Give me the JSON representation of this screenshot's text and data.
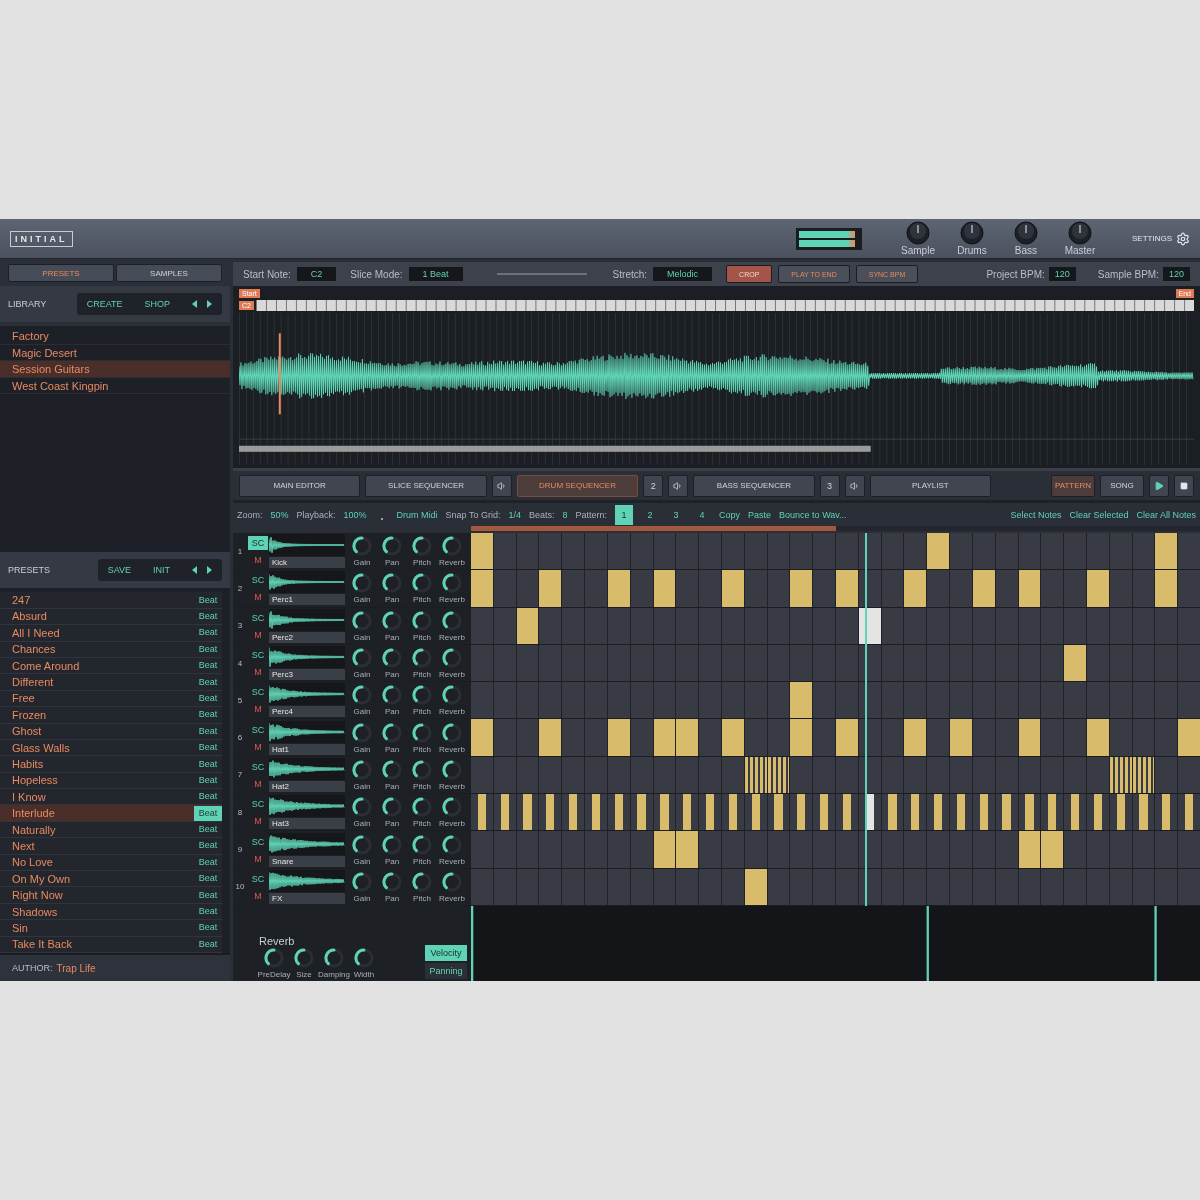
{
  "header": {
    "logo": "INITIAL",
    "meter": {
      "level": 0.93
    },
    "knobs": [
      {
        "label": "Sample"
      },
      {
        "label": "Drums"
      },
      {
        "label": "Bass"
      },
      {
        "label": "Master"
      }
    ],
    "settings": "SETTINGS"
  },
  "sidebar": {
    "tabs": [
      {
        "label": "PRESETS",
        "selected": true
      },
      {
        "label": "SAMPLES",
        "selected": false
      }
    ],
    "library": {
      "title": "LIBRARY",
      "buttons": [
        "CREATE",
        "SHOP"
      ],
      "items": [
        {
          "label": "Factory",
          "selected": false
        },
        {
          "label": "Magic Desert",
          "selected": false
        },
        {
          "label": "Session Guitars",
          "selected": true
        },
        {
          "label": "West Coast Kingpin",
          "selected": false
        }
      ]
    },
    "presets": {
      "title": "PRESETS",
      "buttons": [
        "SAVE",
        "INIT"
      ],
      "items": [
        {
          "name": "247",
          "tag": "Beat",
          "selected": false
        },
        {
          "name": "Absurd",
          "tag": "Beat",
          "selected": false
        },
        {
          "name": "All I Need",
          "tag": "Beat",
          "selected": false
        },
        {
          "name": "Chances",
          "tag": "Beat",
          "selected": false
        },
        {
          "name": "Come Around",
          "tag": "Beat",
          "selected": false
        },
        {
          "name": "Different",
          "tag": "Beat",
          "selected": false
        },
        {
          "name": "Free",
          "tag": "Beat",
          "selected": false
        },
        {
          "name": "Frozen",
          "tag": "Beat",
          "selected": false
        },
        {
          "name": "Ghost",
          "tag": "Beat",
          "selected": false
        },
        {
          "name": "Glass Walls",
          "tag": "Beat",
          "selected": false
        },
        {
          "name": "Habits",
          "tag": "Beat",
          "selected": false
        },
        {
          "name": "Hopeless",
          "tag": "Beat",
          "selected": false
        },
        {
          "name": "I Know",
          "tag": "Beat",
          "selected": false
        },
        {
          "name": "Interlude",
          "tag": "Beat",
          "selected": true
        },
        {
          "name": "Naturally",
          "tag": "Beat",
          "selected": false
        },
        {
          "name": "Next",
          "tag": "Beat",
          "selected": false
        },
        {
          "name": "No Love",
          "tag": "Beat",
          "selected": false
        },
        {
          "name": "On My Own",
          "tag": "Beat",
          "selected": false
        },
        {
          "name": "Right Now",
          "tag": "Beat",
          "selected": false
        },
        {
          "name": "Shadows",
          "tag": "Beat",
          "selected": false
        },
        {
          "name": "Sin",
          "tag": "Beat",
          "selected": false
        },
        {
          "name": "Take It Back",
          "tag": "Beat",
          "selected": false
        }
      ]
    },
    "author": {
      "label": "AUTHOR:",
      "value": "Trap Life"
    }
  },
  "sample_bar": {
    "fields": [
      {
        "label": "Start Note:",
        "value": "C2"
      },
      {
        "label": "Slice Mode:",
        "value": "1 Beat"
      },
      {
        "label": "Stretch:",
        "value": "Melodic"
      }
    ],
    "buttons": [
      {
        "label": "CROP",
        "on": true
      },
      {
        "label": "PLAY TO END",
        "on": false
      },
      {
        "label": "SYNC BPM",
        "on": false
      }
    ],
    "bpm": [
      {
        "label": "Project BPM:",
        "value": "120"
      },
      {
        "label": "Sample BPM:",
        "value": "120"
      }
    ]
  },
  "waveform": {
    "start": "Start",
    "end": "End",
    "note": "C2"
  },
  "editor_tabs": [
    {
      "label": "MAIN EDITOR",
      "selected": false,
      "speaker": false
    },
    {
      "label": "SLICE SEQUENCER",
      "selected": false,
      "speaker": true
    },
    {
      "label": "DRUM SEQUENCER",
      "selected": true,
      "count": "2",
      "speaker": true
    },
    {
      "label": "BASS SEQUENCER",
      "selected": false,
      "count": "3",
      "speaker": true
    },
    {
      "label": "PLAYLIST",
      "selected": false,
      "speaker": false
    }
  ],
  "modes": [
    {
      "label": "PATTERN",
      "selected": true
    },
    {
      "label": "SONG",
      "selected": false
    }
  ],
  "seq_toolbar": {
    "zoom": {
      "label": "Zoom:",
      "value": "50%"
    },
    "playback": {
      "label": "Playback:",
      "value": "100%"
    },
    "drum_midi": "Drum Midi",
    "snap": {
      "label": "Snap To Grid:",
      "value": "1/4"
    },
    "beats": {
      "label": "Beats:",
      "value": "8"
    },
    "pattern": {
      "label": "Pattern:",
      "items": [
        {
          "label": "1",
          "selected": true
        },
        {
          "label": "2",
          "selected": false
        },
        {
          "label": "3",
          "selected": false
        },
        {
          "label": "4",
          "selected": false
        }
      ]
    },
    "actions": [
      "Copy",
      "Paste",
      "Bounce to Wav..."
    ],
    "note_actions": [
      "Select Notes",
      "Clear Selected",
      "Clear All Notes"
    ]
  },
  "loop": {
    "level": 0.5
  },
  "playhead": {
    "level": 0.54
  },
  "tracks": [
    {
      "number": "1",
      "sc": {
        "label": "SC",
        "selected": true
      },
      "mute": "M",
      "name": "Kick",
      "knobs": [
        {
          "label": "Gain"
        },
        {
          "label": "Pan"
        },
        {
          "label": "Pitch"
        },
        {
          "label": "Reverb"
        }
      ],
      "steps": [
        {
          "kind": "on"
        },
        {
          "kind": "off"
        },
        {
          "kind": "off"
        },
        {
          "kind": "off"
        },
        {
          "kind": "off"
        },
        {
          "kind": "off"
        },
        {
          "kind": "off"
        },
        {
          "kind": "off"
        },
        {
          "kind": "off"
        },
        {
          "kind": "off"
        },
        {
          "kind": "off"
        },
        {
          "kind": "off"
        },
        {
          "kind": "off"
        },
        {
          "kind": "off"
        },
        {
          "kind": "off"
        },
        {
          "kind": "off"
        },
        {
          "kind": "off"
        },
        {
          "kind": "off"
        },
        {
          "kind": "off"
        },
        {
          "kind": "off"
        },
        {
          "kind": "on"
        },
        {
          "kind": "off"
        },
        {
          "kind": "off"
        },
        {
          "kind": "off"
        },
        {
          "kind": "off"
        },
        {
          "kind": "off"
        },
        {
          "kind": "off"
        },
        {
          "kind": "off"
        },
        {
          "kind": "off"
        },
        {
          "kind": "off"
        },
        {
          "kind": "on"
        },
        {
          "kind": "off"
        }
      ]
    },
    {
      "number": "2",
      "sc": {
        "label": "SC",
        "selected": false
      },
      "mute": "M",
      "name": "Perc1",
      "knobs": [
        {
          "label": "Gain"
        },
        {
          "label": "Pan"
        },
        {
          "label": "Pitch"
        },
        {
          "label": "Reverb"
        }
      ],
      "steps": [
        {
          "kind": "on"
        },
        {
          "kind": "off"
        },
        {
          "kind": "off"
        },
        {
          "kind": "on"
        },
        {
          "kind": "off"
        },
        {
          "kind": "off"
        },
        {
          "kind": "on"
        },
        {
          "kind": "off"
        },
        {
          "kind": "on"
        },
        {
          "kind": "off"
        },
        {
          "kind": "off"
        },
        {
          "kind": "on"
        },
        {
          "kind": "off"
        },
        {
          "kind": "off"
        },
        {
          "kind": "on"
        },
        {
          "kind": "off"
        },
        {
          "kind": "on"
        },
        {
          "kind": "off"
        },
        {
          "kind": "off"
        },
        {
          "kind": "on"
        },
        {
          "kind": "off"
        },
        {
          "kind": "off"
        },
        {
          "kind": "on"
        },
        {
          "kind": "off"
        },
        {
          "kind": "on"
        },
        {
          "kind": "off"
        },
        {
          "kind": "off"
        },
        {
          "kind": "on"
        },
        {
          "kind": "off"
        },
        {
          "kind": "off"
        },
        {
          "kind": "on"
        },
        {
          "kind": "off"
        }
      ]
    },
    {
      "number": "3",
      "sc": {
        "label": "SC",
        "selected": false
      },
      "mute": "M",
      "name": "Perc2",
      "knobs": [
        {
          "label": "Gain"
        },
        {
          "label": "Pan"
        },
        {
          "label": "Pitch"
        },
        {
          "label": "Reverb"
        }
      ],
      "steps": [
        {
          "kind": "off"
        },
        {
          "kind": "off"
        },
        {
          "kind": "on"
        },
        {
          "kind": "off"
        },
        {
          "kind": "off"
        },
        {
          "kind": "off"
        },
        {
          "kind": "off"
        },
        {
          "kind": "off"
        },
        {
          "kind": "off"
        },
        {
          "kind": "off"
        },
        {
          "kind": "off"
        },
        {
          "kind": "off"
        },
        {
          "kind": "off"
        },
        {
          "kind": "off"
        },
        {
          "kind": "off"
        },
        {
          "kind": "off"
        },
        {
          "kind": "off"
        },
        {
          "kind": "on"
        },
        {
          "kind": "off"
        },
        {
          "kind": "off"
        },
        {
          "kind": "off"
        },
        {
          "kind": "off"
        },
        {
          "kind": "off"
        },
        {
          "kind": "off"
        },
        {
          "kind": "off"
        },
        {
          "kind": "off"
        },
        {
          "kind": "off"
        },
        {
          "kind": "off"
        },
        {
          "kind": "off"
        },
        {
          "kind": "off"
        },
        {
          "kind": "off"
        },
        {
          "kind": "off"
        }
      ]
    },
    {
      "number": "4",
      "sc": {
        "label": "SC",
        "selected": false
      },
      "mute": "M",
      "name": "Perc3",
      "knobs": [
        {
          "label": "Gain"
        },
        {
          "label": "Pan"
        },
        {
          "label": "Pitch"
        },
        {
          "label": "Reverb"
        }
      ],
      "steps": [
        {
          "kind": "off"
        },
        {
          "kind": "off"
        },
        {
          "kind": "off"
        },
        {
          "kind": "off"
        },
        {
          "kind": "off"
        },
        {
          "kind": "off"
        },
        {
          "kind": "off"
        },
        {
          "kind": "off"
        },
        {
          "kind": "off"
        },
        {
          "kind": "off"
        },
        {
          "kind": "off"
        },
        {
          "kind": "off"
        },
        {
          "kind": "off"
        },
        {
          "kind": "off"
        },
        {
          "kind": "off"
        },
        {
          "kind": "off"
        },
        {
          "kind": "off"
        },
        {
          "kind": "off"
        },
        {
          "kind": "off"
        },
        {
          "kind": "off"
        },
        {
          "kind": "off"
        },
        {
          "kind": "off"
        },
        {
          "kind": "off"
        },
        {
          "kind": "off"
        },
        {
          "kind": "off"
        },
        {
          "kind": "off"
        },
        {
          "kind": "on"
        },
        {
          "kind": "off"
        },
        {
          "kind": "off"
        },
        {
          "kind": "off"
        },
        {
          "kind": "off"
        },
        {
          "kind": "off"
        }
      ]
    },
    {
      "number": "5",
      "sc": {
        "label": "SC",
        "selected": false
      },
      "mute": "M",
      "name": "Perc4",
      "knobs": [
        {
          "label": "Gain"
        },
        {
          "label": "Pan"
        },
        {
          "label": "Pitch"
        },
        {
          "label": "Reverb"
        }
      ],
      "steps": [
        {
          "kind": "off"
        },
        {
          "kind": "off"
        },
        {
          "kind": "off"
        },
        {
          "kind": "off"
        },
        {
          "kind": "off"
        },
        {
          "kind": "off"
        },
        {
          "kind": "off"
        },
        {
          "kind": "off"
        },
        {
          "kind": "off"
        },
        {
          "kind": "off"
        },
        {
          "kind": "off"
        },
        {
          "kind": "off"
        },
        {
          "kind": "off"
        },
        {
          "kind": "off"
        },
        {
          "kind": "on"
        },
        {
          "kind": "off"
        },
        {
          "kind": "off"
        },
        {
          "kind": "off"
        },
        {
          "kind": "off"
        },
        {
          "kind": "off"
        },
        {
          "kind": "off"
        },
        {
          "kind": "off"
        },
        {
          "kind": "off"
        },
        {
          "kind": "off"
        },
        {
          "kind": "off"
        },
        {
          "kind": "off"
        },
        {
          "kind": "off"
        },
        {
          "kind": "off"
        },
        {
          "kind": "off"
        },
        {
          "kind": "off"
        },
        {
          "kind": "off"
        },
        {
          "kind": "off"
        }
      ]
    },
    {
      "number": "6",
      "sc": {
        "label": "SC",
        "selected": false
      },
      "mute": "M",
      "name": "Hat1",
      "knobs": [
        {
          "label": "Gain"
        },
        {
          "label": "Pan"
        },
        {
          "label": "Pitch"
        },
        {
          "label": "Reverb"
        }
      ],
      "steps": [
        {
          "kind": "on"
        },
        {
          "kind": "off"
        },
        {
          "kind": "off"
        },
        {
          "kind": "on"
        },
        {
          "kind": "off"
        },
        {
          "kind": "off"
        },
        {
          "kind": "on"
        },
        {
          "kind": "off"
        },
        {
          "kind": "on"
        },
        {
          "kind": "on"
        },
        {
          "kind": "off"
        },
        {
          "kind": "on"
        },
        {
          "kind": "off"
        },
        {
          "kind": "off"
        },
        {
          "kind": "on"
        },
        {
          "kind": "off"
        },
        {
          "kind": "on"
        },
        {
          "kind": "off"
        },
        {
          "kind": "off"
        },
        {
          "kind": "on"
        },
        {
          "kind": "off"
        },
        {
          "kind": "on"
        },
        {
          "kind": "off"
        },
        {
          "kind": "off"
        },
        {
          "kind": "on"
        },
        {
          "kind": "off"
        },
        {
          "kind": "off"
        },
        {
          "kind": "on"
        },
        {
          "kind": "off"
        },
        {
          "kind": "off"
        },
        {
          "kind": "off"
        },
        {
          "kind": "on"
        }
      ]
    },
    {
      "number": "7",
      "sc": {
        "label": "SC",
        "selected": false
      },
      "mute": "M",
      "name": "Hat2",
      "knobs": [
        {
          "label": "Gain"
        },
        {
          "label": "Pan"
        },
        {
          "label": "Pitch"
        },
        {
          "label": "Reverb"
        }
      ],
      "steps": [
        {
          "kind": "off"
        },
        {
          "kind": "off"
        },
        {
          "kind": "off"
        },
        {
          "kind": "off"
        },
        {
          "kind": "off"
        },
        {
          "kind": "off"
        },
        {
          "kind": "off"
        },
        {
          "kind": "off"
        },
        {
          "kind": "off"
        },
        {
          "kind": "off"
        },
        {
          "kind": "off"
        },
        {
          "kind": "off"
        },
        {
          "kind": "roll"
        },
        {
          "kind": "roll"
        },
        {
          "kind": "off"
        },
        {
          "kind": "off"
        },
        {
          "kind": "off"
        },
        {
          "kind": "off"
        },
        {
          "kind": "off"
        },
        {
          "kind": "off"
        },
        {
          "kind": "off"
        },
        {
          "kind": "off"
        },
        {
          "kind": "off"
        },
        {
          "kind": "off"
        },
        {
          "kind": "off"
        },
        {
          "kind": "off"
        },
        {
          "kind": "off"
        },
        {
          "kind": "off"
        },
        {
          "kind": "roll"
        },
        {
          "kind": "roll"
        },
        {
          "kind": "off"
        },
        {
          "kind": "off"
        }
      ]
    },
    {
      "number": "8",
      "sc": {
        "label": "SC",
        "selected": false
      },
      "mute": "M",
      "name": "Hat3",
      "knobs": [
        {
          "label": "Gain"
        },
        {
          "label": "Pan"
        },
        {
          "label": "Pitch"
        },
        {
          "label": "Reverb"
        }
      ],
      "steps": [
        {
          "kind": "short"
        },
        {
          "kind": "short"
        },
        {
          "kind": "short"
        },
        {
          "kind": "short"
        },
        {
          "kind": "short"
        },
        {
          "kind": "short"
        },
        {
          "kind": "short"
        },
        {
          "kind": "short"
        },
        {
          "kind": "short"
        },
        {
          "kind": "short"
        },
        {
          "kind": "short"
        },
        {
          "kind": "short"
        },
        {
          "kind": "short"
        },
        {
          "kind": "short"
        },
        {
          "kind": "short"
        },
        {
          "kind": "short"
        },
        {
          "kind": "short"
        },
        {
          "kind": "short"
        },
        {
          "kind": "short"
        },
        {
          "kind": "short"
        },
        {
          "kind": "short"
        },
        {
          "kind": "short"
        },
        {
          "kind": "short"
        },
        {
          "kind": "short"
        },
        {
          "kind": "short"
        },
        {
          "kind": "short"
        },
        {
          "kind": "short"
        },
        {
          "kind": "short"
        },
        {
          "kind": "short"
        },
        {
          "kind": "short"
        },
        {
          "kind": "short"
        },
        {
          "kind": "short"
        }
      ]
    },
    {
      "number": "9",
      "sc": {
        "label": "SC",
        "selected": false
      },
      "mute": "M",
      "name": "Snare",
      "knobs": [
        {
          "label": "Gain"
        },
        {
          "label": "Pan"
        },
        {
          "label": "Pitch"
        },
        {
          "label": "Reverb"
        }
      ],
      "steps": [
        {
          "kind": "off"
        },
        {
          "kind": "off"
        },
        {
          "kind": "off"
        },
        {
          "kind": "off"
        },
        {
          "kind": "off"
        },
        {
          "kind": "off"
        },
        {
          "kind": "off"
        },
        {
          "kind": "off"
        },
        {
          "kind": "on"
        },
        {
          "kind": "on"
        },
        {
          "kind": "off"
        },
        {
          "kind": "off"
        },
        {
          "kind": "off"
        },
        {
          "kind": "off"
        },
        {
          "kind": "off"
        },
        {
          "kind": "off"
        },
        {
          "kind": "off"
        },
        {
          "kind": "off"
        },
        {
          "kind": "off"
        },
        {
          "kind": "off"
        },
        {
          "kind": "off"
        },
        {
          "kind": "off"
        },
        {
          "kind": "off"
        },
        {
          "kind": "off"
        },
        {
          "kind": "on"
        },
        {
          "kind": "on"
        },
        {
          "kind": "off"
        },
        {
          "kind": "off"
        },
        {
          "kind": "off"
        },
        {
          "kind": "off"
        },
        {
          "kind": "off"
        },
        {
          "kind": "off"
        }
      ]
    },
    {
      "number": "10",
      "sc": {
        "label": "SC",
        "selected": false
      },
      "mute": "M",
      "name": "FX",
      "knobs": [
        {
          "label": "Gain"
        },
        {
          "label": "Pan"
        },
        {
          "label": "Pitch"
        },
        {
          "label": "Reverb"
        }
      ],
      "steps": [
        {
          "kind": "off"
        },
        {
          "kind": "off"
        },
        {
          "kind": "off"
        },
        {
          "kind": "off"
        },
        {
          "kind": "off"
        },
        {
          "kind": "off"
        },
        {
          "kind": "off"
        },
        {
          "kind": "off"
        },
        {
          "kind": "off"
        },
        {
          "kind": "off"
        },
        {
          "kind": "off"
        },
        {
          "kind": "off"
        },
        {
          "kind": "on"
        },
        {
          "kind": "off"
        },
        {
          "kind": "off"
        },
        {
          "kind": "off"
        },
        {
          "kind": "off"
        },
        {
          "kind": "off"
        },
        {
          "kind": "off"
        },
        {
          "kind": "off"
        },
        {
          "kind": "off"
        },
        {
          "kind": "off"
        },
        {
          "kind": "off"
        },
        {
          "kind": "off"
        },
        {
          "kind": "off"
        },
        {
          "kind": "off"
        },
        {
          "kind": "off"
        },
        {
          "kind": "off"
        },
        {
          "kind": "off"
        },
        {
          "kind": "off"
        },
        {
          "kind": "off"
        },
        {
          "kind": "off"
        }
      ]
    }
  ],
  "reverb": {
    "title": "Reverb",
    "knobs": [
      {
        "label": "PreDelay"
      },
      {
        "label": "Size"
      },
      {
        "label": "Damping"
      },
      {
        "label": "Width"
      }
    ]
  },
  "lanes": [
    {
      "label": "Velocity",
      "selected": true
    },
    {
      "label": "Panning",
      "selected": false
    }
  ]
}
